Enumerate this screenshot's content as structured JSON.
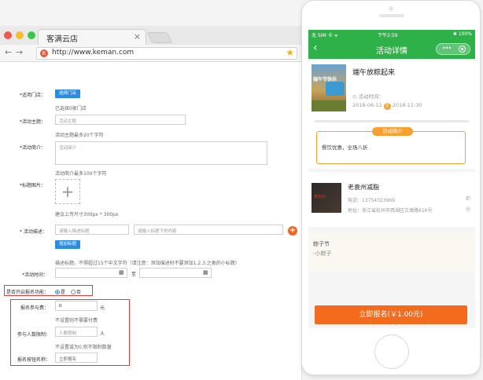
{
  "browser": {
    "tab_title": "客满云店",
    "tab_close": "×",
    "url": "http://www.keman.com"
  },
  "form": {
    "store_label": "*适用门店：",
    "store_button": "选择门店",
    "store_hint": "已选择0家门店",
    "subject_label": "*活动主题：",
    "subject_placeholder": "活动主题",
    "subject_hint": "活动主题最多20个字符",
    "intro_label": "*活动简介：",
    "intro_placeholder": "活动简介",
    "intro_hint": "活动简介最多100个字符",
    "image_label": "*标题图片：",
    "image_hint": "建议上传尺寸300px * 300px",
    "desc_label": "* 活动描述：",
    "desc_title_placeholder": "请输入描述标题",
    "desc_content_placeholder": "请输入标题下的内容",
    "add_title_button": "增加标题",
    "desc_hint": "描述标题，不得超过15个中文字符（请注意：添加描述时不要添加1.2.3.之类的小标题）",
    "time_label": "*活动时间：",
    "time_to": "至",
    "signup_enable_label": "是否开启报名功能：",
    "signup_yes": "是",
    "signup_no": "否",
    "fee_label": "报名参与费：",
    "fee_value": "0",
    "fee_unit": "元",
    "fee_hint": "不设置则不需要付费",
    "limit_label": "参与人数限制：",
    "limit_placeholder": "人数限制",
    "limit_unit": "人",
    "limit_hint": "不设置或为0,则不限制数量",
    "btn_name_label": "报名按钮名称：",
    "btn_name_value": "立即报名"
  },
  "phone": {
    "status_left": "无 SIM 卡 ᯤ",
    "status_time": "下午2:59",
    "status_right": "✱ 100%",
    "nav_title": "活动详情",
    "poster_text": "端午节快乐",
    "activity_title": "端午放粽起来",
    "time_label": "活动时间：",
    "start_date": "2018-06-12",
    "to_badge": "至",
    "end_date": "2018-11-30",
    "intro_tag": "活动简介",
    "intro_text": "餐饮优惠，全场八折",
    "shop_img_text": "老袁州",
    "shop_name": "老袁州减脂",
    "shop_phone": "电话：13754323969",
    "shop_addr": "地址：浙江省杭州市西湖区古墩路616号",
    "extra_name": "粽子节",
    "extra_sub": "-小粽子",
    "signup_button": "立即报名(￥1.00元)"
  }
}
